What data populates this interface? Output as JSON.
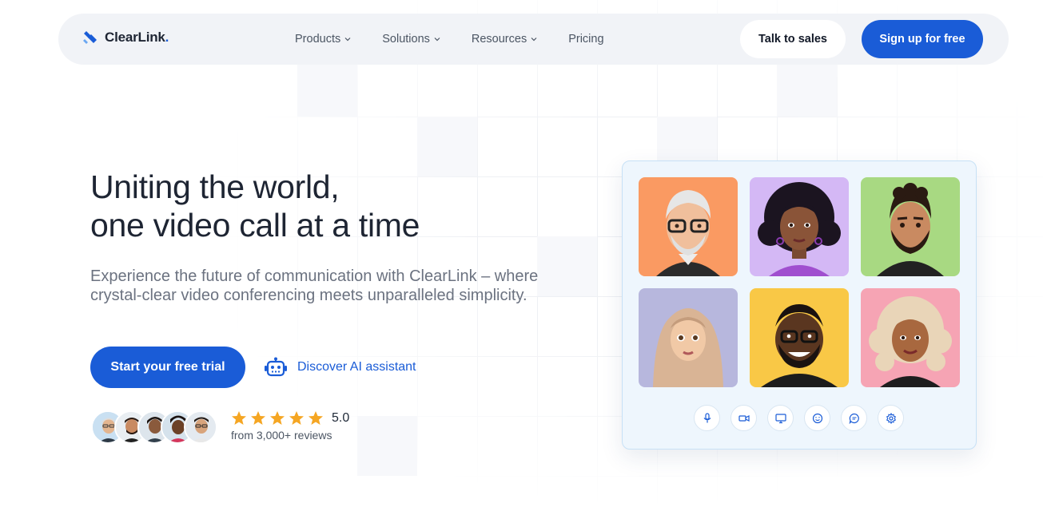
{
  "brand": {
    "name": "ClearLink",
    "dot": ".",
    "accent": "#1a5cd7"
  },
  "nav": {
    "items": [
      {
        "label": "Products",
        "has_dropdown": true
      },
      {
        "label": "Solutions",
        "has_dropdown": true
      },
      {
        "label": "Resources",
        "has_dropdown": true
      },
      {
        "label": "Pricing",
        "has_dropdown": false
      }
    ],
    "talk_to_sales": "Talk to sales",
    "sign_up": "Sign up for free"
  },
  "hero": {
    "headline_line1": "Uniting the world,",
    "headline_line2": "one video call at a time",
    "subtext": "Experience the future of communication with ClearLink – where crystal-clear video conferencing meets unparalleled simplicity.",
    "cta_primary": "Start your free trial",
    "cta_secondary": "Discover AI assistant",
    "cta_secondary_icon": "robot-icon"
  },
  "social_proof": {
    "avatar_count": 5,
    "rating": "5.0",
    "stars": 5,
    "reviews": "from 3,000+ reviews",
    "star_color": "#f5a623"
  },
  "video_call": {
    "participants": [
      {
        "name": "participant-older-man-glasses",
        "bg": "#fa9a62"
      },
      {
        "name": "participant-woman-curly-hair",
        "bg": "#d4b8f5"
      },
      {
        "name": "participant-man-beard",
        "bg": "#a8d982"
      },
      {
        "name": "participant-woman-hijab",
        "bg": "#b7b7dd"
      },
      {
        "name": "participant-man-glasses-smiling",
        "bg": "#f9c846"
      },
      {
        "name": "participant-woman-blonde-curls",
        "bg": "#f6a4b4"
      }
    ],
    "controls": [
      "microphone-icon",
      "camera-icon",
      "screen-share-icon",
      "emoji-icon",
      "chat-icon",
      "settings-icon"
    ]
  }
}
